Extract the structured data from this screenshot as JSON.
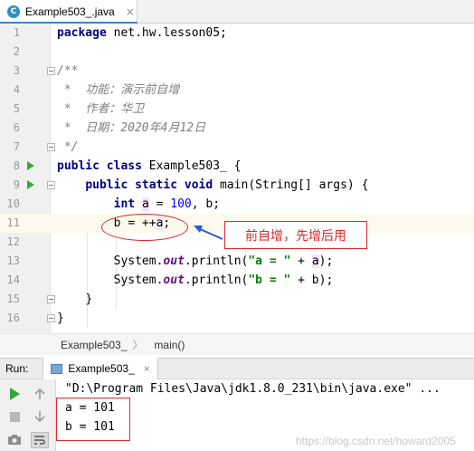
{
  "editor_tab": {
    "icon": "java-class-icon",
    "title": "Example503_.java",
    "close": "×"
  },
  "code_lines": [
    {
      "num": "1"
    },
    {
      "num": "2"
    },
    {
      "num": "3"
    },
    {
      "num": "4"
    },
    {
      "num": "5"
    },
    {
      "num": "6"
    },
    {
      "num": "7"
    },
    {
      "num": "8"
    },
    {
      "num": "9"
    },
    {
      "num": "10"
    },
    {
      "num": "11"
    },
    {
      "num": "12"
    },
    {
      "num": "13"
    },
    {
      "num": "14"
    },
    {
      "num": "15"
    },
    {
      "num": "16"
    }
  ],
  "code": {
    "l1": {
      "kw": "package",
      "rest": " net.hw.lesson05;"
    },
    "l3": "/**",
    "l4": " *  功能：演示前自增",
    "l5": " *  作者：华卫",
    "l6": " *  日期：2020年4月12日",
    "l7": " */",
    "l8": {
      "kw": "public class",
      "rest": " Example503_ {"
    },
    "l9": {
      "kw": "public static void",
      "rest": " main(String[] args) {"
    },
    "l10": {
      "kw": "int",
      "a": "a",
      "eq": " = ",
      "n": "100",
      "rest": ", b;"
    },
    "l11": {
      "pre": "b = ++",
      "a": "a",
      "rest": ";"
    },
    "l13": {
      "pre": "System.",
      "fld": "out",
      "mid": ".println(",
      "str": "\"a = \"",
      "plus": " + ",
      "a": "a",
      "rest": ");"
    },
    "l14": {
      "pre": "System.",
      "fld": "out",
      "mid": ".println(",
      "str": "\"b = \"",
      "rest": " + b);"
    },
    "l15": "}",
    "l16": "}"
  },
  "annotation": {
    "note": "前自增，先增后用"
  },
  "breadcrumb": {
    "class": "Example503_",
    "method": "main()"
  },
  "run_panel": {
    "label": "Run:",
    "tab": "Example503_",
    "tab_close": "×",
    "command": "\"D:\\Program Files\\Java\\jdk1.8.0_231\\bin\\java.exe\" ...",
    "output": [
      "a = 101",
      "b = 101"
    ],
    "watermark": "https://blog.csdn.net/howard2005"
  },
  "colors": {
    "keyword": "#000080",
    "number": "#0000ff",
    "string": "#008000",
    "comment": "#808080",
    "annotation": "#e0262b",
    "run": "#3aa63a"
  }
}
